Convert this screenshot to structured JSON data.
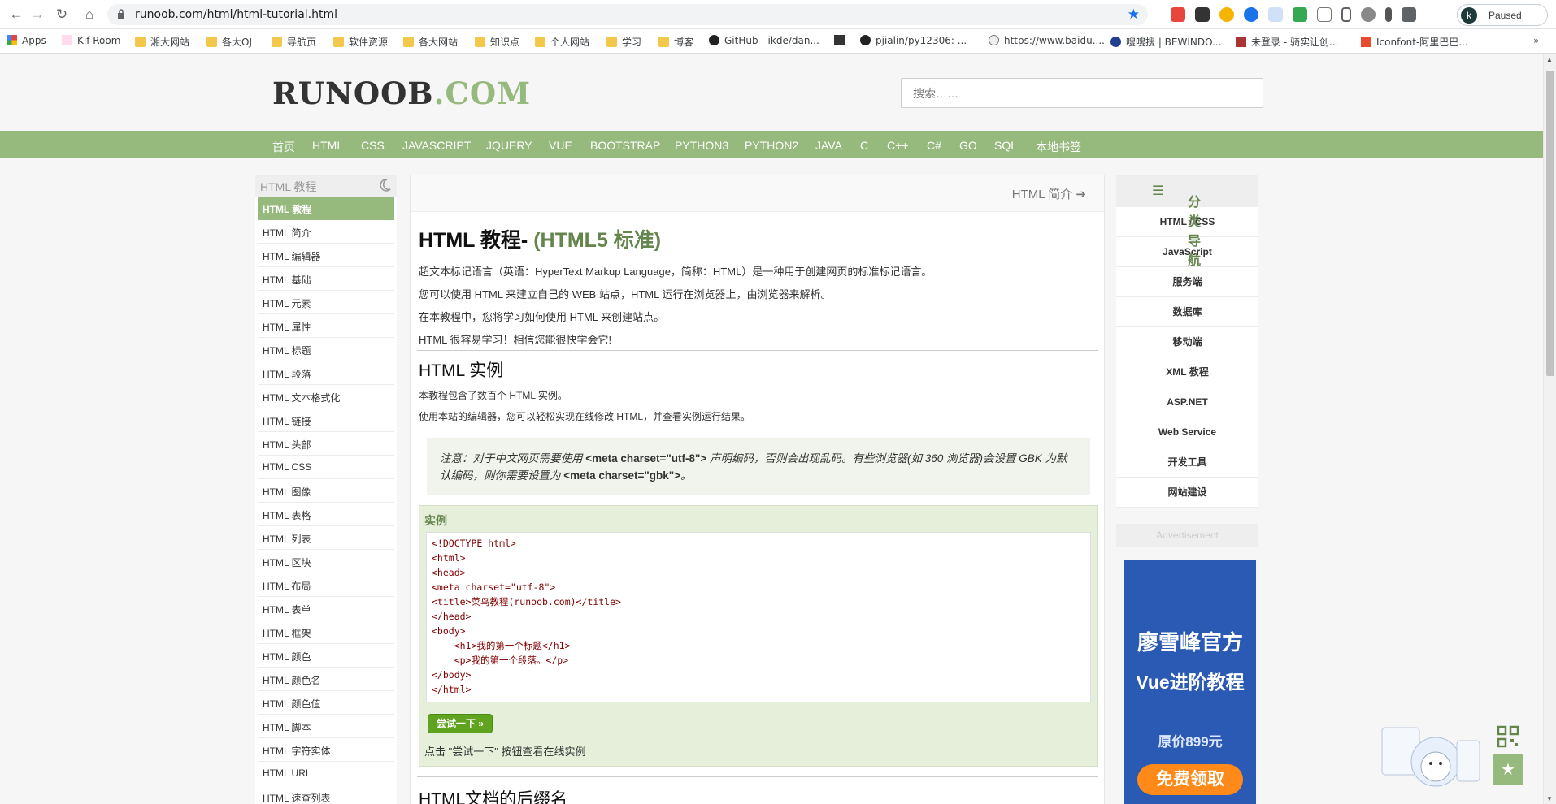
{
  "browser": {
    "url": "runoob.com/html/html-tutorial.html",
    "profile_initial": "k",
    "profile_status": "Paused"
  },
  "bookmarks": [
    "Apps",
    "Kif Room",
    "湘大网站",
    "各大OJ",
    "导航页",
    "软件资源",
    "各大网站",
    "知识点",
    "个人网站",
    "学习",
    "博客",
    "GitHub - ikde/dan...",
    "pjialin/py12306: ...",
    "https://www.baidu....",
    "嗖嗖搜 | BEWINDO...",
    "未登录 - 骑实让创...",
    "Iconfont-阿里巴巴..."
  ],
  "site": {
    "logo_main": "RUNOOB",
    "logo_suffix": ".COM",
    "search_placeholder": "搜索……"
  },
  "topnav": [
    "首页",
    "HTML",
    "CSS",
    "JAVASCRIPT",
    "JQUERY",
    "VUE",
    "BOOTSTRAP",
    "PYTHON3",
    "PYTHON2",
    "JAVA",
    "C",
    "C++",
    "C#",
    "GO",
    "SQL",
    "本地书签"
  ],
  "sidebar": {
    "title": "HTML 教程",
    "items": [
      "HTML 教程",
      "HTML 简介",
      "HTML 编辑器",
      "HTML 基础",
      "HTML 元素",
      "HTML 属性",
      "HTML 标题",
      "HTML 段落",
      "HTML 文本格式化",
      "HTML 链接",
      "HTML 头部",
      "HTML CSS",
      "HTML 图像",
      "HTML 表格",
      "HTML 列表",
      "HTML 区块",
      "HTML 布局",
      "HTML 表单",
      "HTML 框架",
      "HTML 颜色",
      "HTML 颜色名",
      "HTML 颜色值",
      "HTML 脚本",
      "HTML 字符实体",
      "HTML URL",
      "HTML 速查列表"
    ]
  },
  "main": {
    "next_link": "HTML 简介",
    "title": "HTML 教程-",
    "title_highlight": "(HTML5 标准)",
    "intro": [
      "超文本标记语言（英语：HyperText Markup Language，简称：HTML）是一种用于创建网页的标准标记语言。",
      "您可以使用 HTML 来建立自己的 WEB 站点，HTML 运行在浏览器上，由浏览器来解析。",
      "在本教程中，您将学习如何使用 HTML 来创建站点。",
      "HTML 很容易学习！相信您能很快学会它!"
    ],
    "h2_example": "HTML 实例",
    "example_p1": "本教程包含了数百个 HTML 实例。",
    "example_p2": "使用本站的编辑器，您可以轻松实现在线修改 HTML，并查看实例运行结果。",
    "note_prefix": "注意：对于中文网页需要使用",
    "note_code1": "<meta charset=\"utf-8\">",
    "note_mid": "声明编码，否则会出现乱码。有些浏览器(如 360 浏览器)会设置 GBK 为默认编码，则你需要设置为",
    "note_code2": "<meta charset=\"gbk\">",
    "note_end": "。",
    "example_label": "实例",
    "try_button": "尝试一下 »",
    "try_hint": "点击 \"尝试一下\" 按钮查看在线实例",
    "h2_suffix": "HTML文档的后缀名"
  },
  "code_lines": [
    "<!DOCTYPE html>",
    "<html>",
    "<head>",
    "<meta charset=\"utf-8\">",
    "<title>菜鸟教程(runoob.com)</title>",
    "</head>",
    "<body>",
    "    <h1>我的第一个标题</h1>",
    "    <p>我的第一个段落。</p>",
    "</body>",
    "</html>"
  ],
  "right": {
    "title": "分类导航",
    "items": [
      "HTML / CSS",
      "JavaScript",
      "服务端",
      "数据库",
      "移动端",
      "XML 教程",
      "ASP.NET",
      "Web Service",
      "开发工具",
      "网站建设"
    ],
    "advertisement": "Advertisement",
    "ad_title1": "廖雪峰官方",
    "ad_title2": "Vue进阶教程",
    "ad_price": "原价899元",
    "ad_button": "免费领取"
  },
  "colors": {
    "brand_green": "#96b97d",
    "dark_green": "#64854c",
    "try_green": "#5fa31f"
  }
}
